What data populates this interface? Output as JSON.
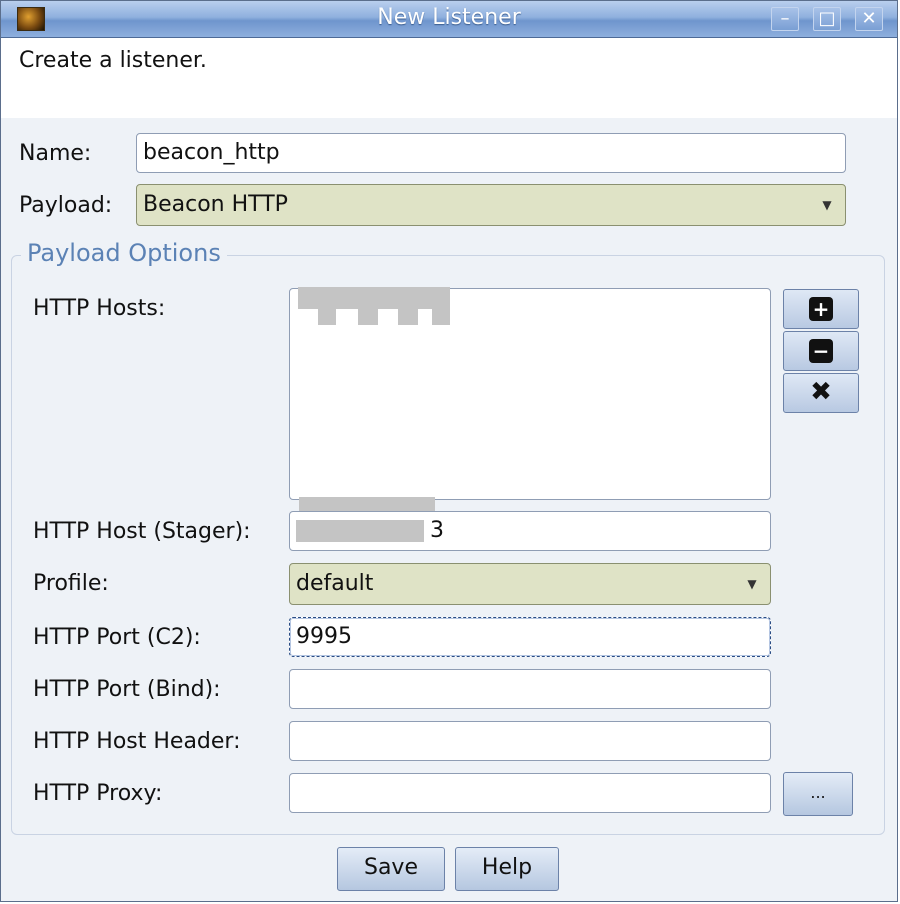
{
  "window": {
    "title": "New Listener",
    "min_glyph": "–",
    "max_glyph": "□",
    "close_glyph": "✕"
  },
  "description": "Create a listener.",
  "name": {
    "label": "Name:",
    "value": "beacon_http"
  },
  "payload": {
    "label": "Payload:",
    "value": "Beacon HTTP"
  },
  "group": {
    "title": "Payload Options",
    "http_hosts": {
      "label": "HTTP Hosts:"
    },
    "host_buttons": {
      "add": "+",
      "remove": "−",
      "clear": "✖"
    },
    "http_host_stager": {
      "label": "HTTP Host (Stager):",
      "value": "3"
    },
    "profile": {
      "label": "Profile:",
      "value": "default"
    },
    "http_port_c2": {
      "label": "HTTP Port (C2):",
      "value": "9995"
    },
    "http_port_bind": {
      "label": "HTTP Port (Bind):",
      "value": ""
    },
    "http_host_header": {
      "label": "HTTP Host Header:",
      "value": ""
    },
    "http_proxy": {
      "label": "HTTP Proxy:",
      "value": "",
      "button": "..."
    }
  },
  "buttons": {
    "save": "Save",
    "help": "Help"
  },
  "colors": {
    "titlebar": "#8fb0de",
    "group_title": "#5b82b5",
    "combo_bg": "#dfe3c6"
  }
}
